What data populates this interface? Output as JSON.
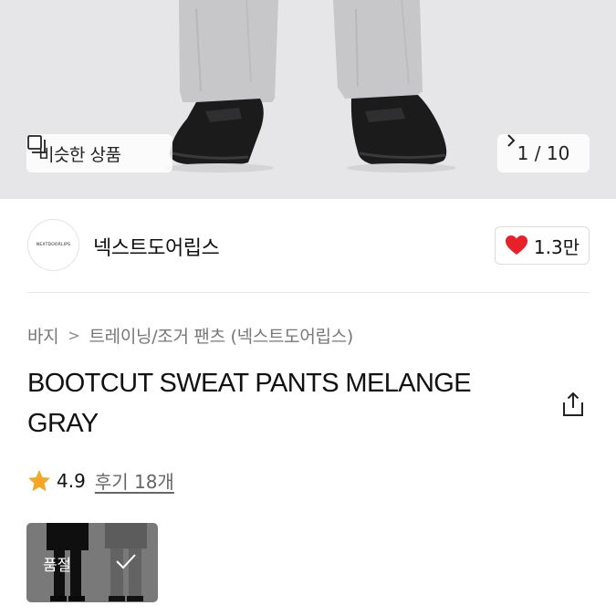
{
  "hero": {
    "similar_label": "비슷한 상품",
    "similar_icon": "similar-items-icon",
    "pager_current": "1",
    "pager_separator": " / ",
    "pager_total": "10"
  },
  "brand": {
    "logo_text": "NEXTDOORLIPS",
    "name": "넥스트도어립스",
    "like_count": "1.3만",
    "like_color": "#e8202a"
  },
  "breadcrumb": [
    "바지",
    "트레이닝/조거 팬츠 (넥스트도어립스)"
  ],
  "product": {
    "title_line1": "BOOTCUT SWEAT PANTS MELANGE",
    "title_line2": "GRAY"
  },
  "rating": {
    "score": "4.9",
    "reviews": "후기 18개",
    "star_color": "#f5a623"
  },
  "options": [
    {
      "status": "품절",
      "selected": true
    }
  ]
}
